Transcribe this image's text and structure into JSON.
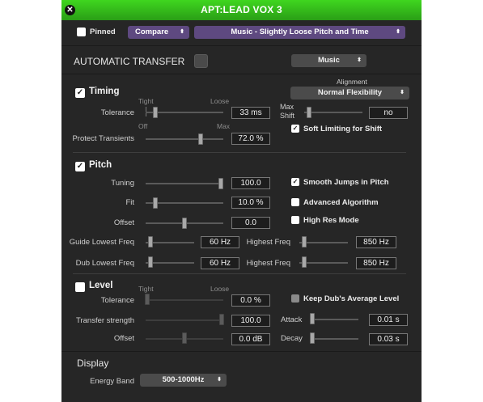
{
  "window": {
    "title": "APT:LEAD VOX 3"
  },
  "toolbar": {
    "pinned_label": "Pinned",
    "compare_label": "Compare",
    "preset_label": "Music - Slightly Loose Pitch and Time",
    "arrow": "⬍"
  },
  "automatic_transfer": {
    "label": "AUTOMATIC TRANSFER",
    "mode_value": "Music"
  },
  "timing": {
    "title": "Timing",
    "checked": true,
    "alignment_label": "Alignment",
    "alignment_value": "Normal Flexibility",
    "tolerance_label": "Tolerance",
    "tight_label": "Tight",
    "loose_label": "Loose",
    "tolerance_value": "33 ms",
    "tolerance_level": 0.1,
    "max_shift_label_1": "Max",
    "max_shift_label_2": "Shift",
    "max_shift_value": "no",
    "max_shift_level": 0.05,
    "protect_label": "Protect Transients",
    "off_label": "Off",
    "max_label": "Max",
    "protect_value": "72.0 %",
    "protect_level": 0.72,
    "soft_limiting_label": "Soft Limiting for Shift",
    "soft_limiting_checked": true
  },
  "pitch": {
    "title": "Pitch",
    "checked": true,
    "tuning_label": "Tuning",
    "tuning_value": "100.0",
    "tuning_level": 1.0,
    "fit_label": "Fit",
    "fit_value": "10.0 %",
    "fit_level": 0.1,
    "offset_label": "Offset",
    "offset_value": "0.0",
    "offset_level": 0.5,
    "smooth_label": "Smooth Jumps in Pitch",
    "smooth_checked": true,
    "advanced_label": "Advanced Algorithm",
    "highres_label": "High Res Mode",
    "guide_lowest_label": "Guide Lowest Freq",
    "guide_lowest_value": "60 Hz",
    "guide_highest_label": "Highest Freq",
    "guide_highest_value": "850 Hz",
    "dub_lowest_label": "Dub Lowest Freq",
    "dub_lowest_value": "60 Hz",
    "dub_highest_label": "Highest Freq",
    "dub_highest_value": "850 Hz"
  },
  "level": {
    "title": "Level",
    "checked": false,
    "tolerance_label": "Tolerance",
    "tight_label": "Tight",
    "loose_label": "Loose",
    "tolerance_value": "0.0 %",
    "transfer_label": "Transfer strength",
    "transfer_value": "100.0",
    "offset_label": "Offset",
    "offset_value": "0.0 dB",
    "keep_label": "Keep Dub's Average Level",
    "attack_label": "Attack",
    "attack_value": "0.01 s",
    "decay_label": "Decay",
    "decay_value": "0.03 s"
  },
  "display": {
    "title": "Display",
    "energy_band_label": "Energy Band",
    "energy_band_value": "500-1000Hz"
  },
  "icons": {
    "close": "close-icon",
    "check": "✓"
  },
  "colors": {
    "titlebar": "#3fd61f",
    "preset_bg": "#5e4980",
    "panel_bg": "#262626"
  }
}
